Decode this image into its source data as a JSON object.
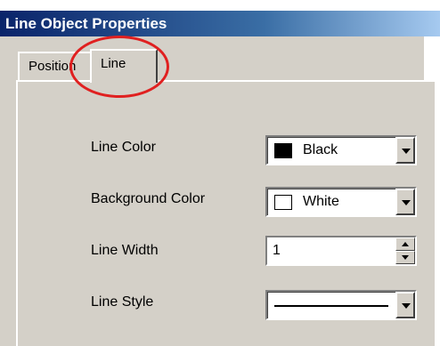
{
  "window": {
    "title": "Line Object Properties"
  },
  "tabs": [
    {
      "label": "Position",
      "selected": false
    },
    {
      "label": "Line",
      "selected": true
    }
  ],
  "fields": {
    "line_color": {
      "label": "Line Color",
      "value": "Black",
      "swatch": "#000000"
    },
    "background_color": {
      "label": "Background Color",
      "value": "White",
      "swatch": "#ffffff"
    },
    "line_width": {
      "label": "Line Width",
      "value": "1"
    },
    "line_style": {
      "label": "Line Style",
      "value": "solid"
    }
  },
  "annotation": {
    "color": "#e02020",
    "target": "tab-line"
  }
}
